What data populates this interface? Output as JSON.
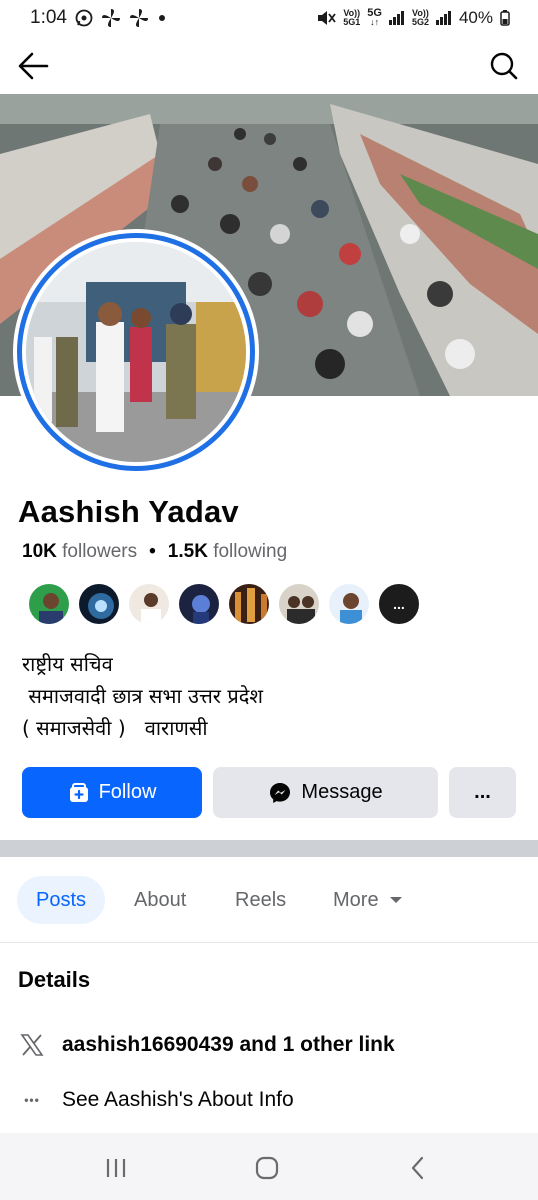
{
  "status_bar": {
    "time": "1:04",
    "battery": "40%",
    "icons": [
      "whatsapp-icon",
      "pinwheel-icon",
      "pinwheel-icon",
      "dot-icon",
      "mute-icon",
      "volte-icon",
      "5g-icon",
      "signal-icon",
      "volte-icon",
      "signal-icon",
      "battery-icon"
    ],
    "sim1_top": "Vo))",
    "sim1_bottom": "5G1",
    "net_top": "5G",
    "net_bottom": "↓↑",
    "sim2_top": "Vo))",
    "sim2_bottom": "5G2"
  },
  "top_nav": {
    "back_icon": "arrow-left-icon",
    "search_icon": "search-icon"
  },
  "profile": {
    "name": "Aashish Yadav",
    "followers_count": "10K",
    "followers_label": "followers",
    "separator": "•",
    "following_count": "1.5K",
    "following_label": "following",
    "bio_lines": [
      "राष्ट्रीय सचिव",
      " समाजवादी छात्र सभा उत्तर प्रदेश",
      "( समाजसेवी )   वाराणसी"
    ]
  },
  "friends_more_label": "...",
  "actions": {
    "follow_label": "Follow",
    "message_label": "Message",
    "more_label": "..."
  },
  "tabs": {
    "posts": "Posts",
    "about": "About",
    "reels": "Reels",
    "more": "More"
  },
  "details": {
    "title": "Details",
    "link_text": "aashish16690439 and 1 other link",
    "about_text": "See Aashish's About Info",
    "about_icon_glyph": "•••"
  },
  "colors": {
    "accent": "#0866ff",
    "button_gray": "#e4e6eb",
    "secondary_text": "#65676b",
    "avatar_ring": "#1f6fe5"
  }
}
